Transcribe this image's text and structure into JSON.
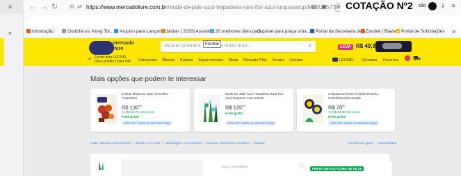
{
  "left_window": {
    "menu_icon": "≡",
    "chevron": "»"
  },
  "browser": {
    "back": "←",
    "forward": "→",
    "reload": "↻",
    "shield": "⊙",
    "tabs_icon": "⇄",
    "url_domain": "https://www.mercadolivre.com.br",
    "url_rest": "/muda-de-jade-azul-trepadeira-rara-flor-azul-turquesa/up/MLBU35774",
    "zoom": "80%",
    "star": "☆",
    "login_label": "Iniciar sessão",
    "ext_icon": "⇩",
    "menu": "≡",
    "chevron": "»"
  },
  "cotacao_label": "COTAÇÃO Nº2",
  "bookmarks": [
    {
      "label": "Introdução",
      "color": "#e05a2b"
    },
    {
      "label": "Godzilla vs. Kong Tor...",
      "color": "#9a9a9a"
    },
    {
      "label": "Arquivo para Lançame...",
      "color": "#3c8fd6"
    },
    {
      "label": "Mulan ( 2020) Assistir ...",
      "color": "#d88c1a"
    },
    {
      "label": "20 melhores sites para ...",
      "color": "#4ba3d6"
    },
    {
      "label": "G ponte para praça urba...",
      "color": "#cfcfcf"
    },
    {
      "label": "Portal da Secretaria de...",
      "color": "#2a5db0"
    },
    {
      "label": "Double | Blaze",
      "color": "#e05a2b"
    },
    {
      "label": "Portal de Solicitações",
      "color": "#f0c800"
    }
  ],
  "header": {
    "logo_line1": "mercado",
    "logo_line2": "livre",
    "search_placeholder": "Buscar produtos, marcas e muito mais...",
    "tooltip": "Fechar",
    "promo_tag": "LOJA",
    "promo_price": "R$ 49,90",
    "location_line1": "Enviar para LEONEL",
    "location_line2": "Rua Leolofio Costa 949",
    "nav_links": [
      "Categorias",
      "Ofertas",
      "Cupons",
      "Supermercado",
      "Moda",
      "Mercado Play",
      "Vender",
      "Contato"
    ],
    "user_name": "LEONEL",
    "right_links": [
      "Compras",
      "Favoritos"
    ],
    "cart_icon": "🛒"
  },
  "content": {
    "section_title": "Mais opções que podem te interessar",
    "cards": [
      {
        "title": "Enfeite Muda De Jade Vermelha - Trepadeira",
        "price": "R$ 130",
        "price_cents": "00",
        "installments": "4x R$ 32,70 sem juros",
        "shipping": "Frete grátis",
        "badge": "10% OFF Saldo no Mercado Pago"
      },
      {
        "title": "Muda De Jade Azul Trepadeira Rara Flor Azul Turquesa Azul-celeste",
        "price": "R$ 135",
        "price_cents": "00",
        "installments": "",
        "shipping": "Frete grátis",
        "badge": "10% OFF Saldo no Mercado Pago"
      },
      {
        "title": "2 Mudas De Rosa Amarela Roseira Colombiana Enxertada",
        "price": "R$ 78",
        "price_cents": "90",
        "installments": "7x R$ 14,90 sem juros",
        "shipping": "Frete grátis",
        "badge": "10% OFF Saldo no Mercado Pago"
      }
    ],
    "breadcrumbs": [
      "Casa, Móveis e Decoração",
      "Jardim e Ar Livre",
      "Jardinagem e Acessórios",
      "Plantas, Sementes e Cultivo",
      "Plantas"
    ],
    "breadcrumb_sep": ">",
    "right_links": [
      "Vender um igual",
      "Compartilhar"
    ],
    "result_meta": "Novo | 4 vendidos",
    "ship_badge": "FRETE GRÁTIS ACIMA DE R$ 19"
  }
}
